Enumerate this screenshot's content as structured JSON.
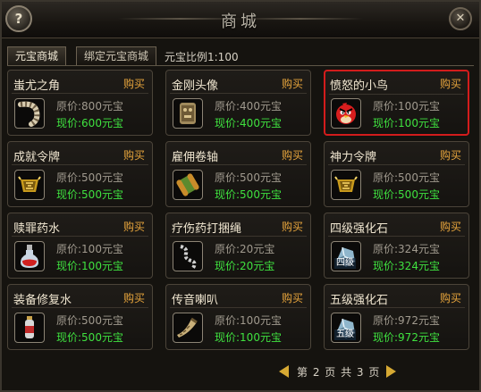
{
  "window": {
    "title": "商城",
    "help_label": "?",
    "close_label": "✕"
  },
  "tabs": [
    {
      "label": "元宝商城",
      "active": true
    },
    {
      "label": "绑定元宝商城",
      "active": false
    }
  ],
  "ratio_text": "元宝比例1:100",
  "buy_label": "购买",
  "items": [
    {
      "name": "蚩尤之角",
      "orig": "原价:800元宝",
      "now": "现价:600元宝",
      "icon": "horn-icon"
    },
    {
      "name": "金刚头像",
      "orig": "原价:400元宝",
      "now": "现价:400元宝",
      "icon": "stone-idol-icon"
    },
    {
      "name": "愤怒的小鸟",
      "orig": "原价:100元宝",
      "now": "现价:100元宝",
      "icon": "angry-bird-icon",
      "selected": true
    },
    {
      "name": "成就令牌",
      "orig": "原价:500元宝",
      "now": "现价:500元宝",
      "icon": "golden-token-icon"
    },
    {
      "name": "雇佣卷轴",
      "orig": "原价:500元宝",
      "now": "现价:500元宝",
      "icon": "scroll-icon"
    },
    {
      "name": "神力令牌",
      "orig": "原价:500元宝",
      "now": "现价:500元宝",
      "icon": "golden-token-icon"
    },
    {
      "name": "赎罪药水",
      "orig": "原价:100元宝",
      "now": "现价:100元宝",
      "icon": "potion-flask-icon"
    },
    {
      "name": "疗伤药打捆绳",
      "orig": "原价:20元宝",
      "now": "现价:20元宝",
      "icon": "rope-coil-icon"
    },
    {
      "name": "四级强化石",
      "orig": "原价:324元宝",
      "now": "现价:324元宝",
      "icon": "crystal-stone-icon",
      "tag": "四级"
    },
    {
      "name": "装备修复水",
      "orig": "原价:500元宝",
      "now": "现价:500元宝",
      "icon": "repair-bottle-icon"
    },
    {
      "name": "传音喇叭",
      "orig": "原价:100元宝",
      "now": "现价:100元宝",
      "icon": "megaphone-horn-icon"
    },
    {
      "name": "五级强化石",
      "orig": "原价:972元宝",
      "now": "现价:972元宝",
      "icon": "crystal-stone-icon",
      "tag": "五级"
    }
  ],
  "pagination": {
    "text": "第 2 页 共 3 页",
    "current": 2,
    "total": 3
  },
  "colors": {
    "buy": "#e6a43c",
    "current_price": "#3fe13f",
    "selected_border": "#d31c1c",
    "arrow": "#d6a933"
  }
}
